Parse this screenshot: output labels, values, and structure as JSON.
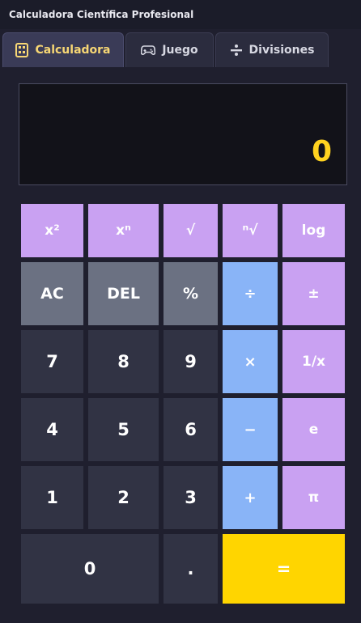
{
  "window": {
    "title": "Calculadora Científica Profesional"
  },
  "tabs": [
    {
      "label": "Calculadora",
      "icon": "calculator-icon",
      "active": true
    },
    {
      "label": "Juego",
      "icon": "gamepad-icon",
      "active": false
    },
    {
      "label": "Divisiones",
      "icon": "divide-icon",
      "active": false
    }
  ],
  "display": {
    "value": "0"
  },
  "keys": {
    "square": "x²",
    "power": "xⁿ",
    "sqrt": "√",
    "nroot": "ⁿ√",
    "log": "log",
    "ac": "AC",
    "del": "DEL",
    "percent": "%",
    "divide": "÷",
    "plus_minus": "±",
    "seven": "7",
    "eight": "8",
    "nine": "9",
    "multiply": "×",
    "reciprocal": "1/x",
    "four": "4",
    "five": "5",
    "six": "6",
    "minus": "−",
    "e": "e",
    "one": "1",
    "two": "2",
    "three": "3",
    "plus": "+",
    "pi": "π",
    "zero": "0",
    "dot": ".",
    "equals": "="
  },
  "colors": {
    "function_key": "#c9a1f2",
    "control_key": "#6b7182",
    "number_key": "#313344",
    "operator_key": "#89b4f7",
    "equals_key": "#ffd500",
    "display_text": "#ffd21f",
    "active_tab_text": "#f7d774"
  }
}
